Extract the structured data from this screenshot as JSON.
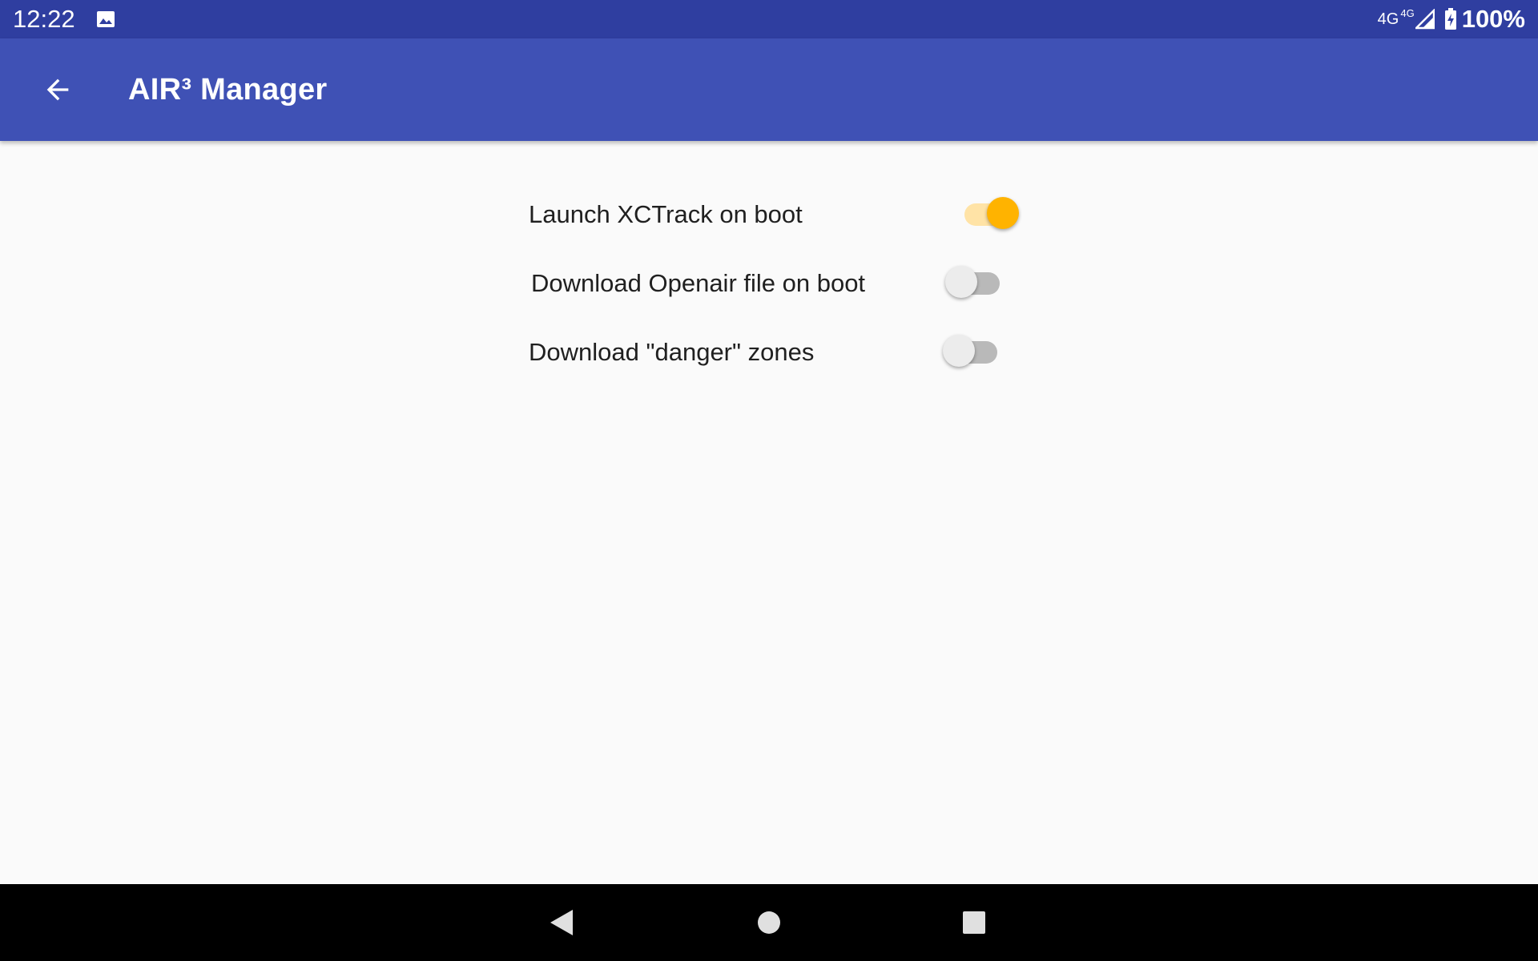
{
  "status_bar": {
    "time": "12:22",
    "network": "4G",
    "network_secondary": "4G",
    "battery": "100%",
    "icons": [
      "image-icon",
      "signal-icon",
      "battery-charging-icon"
    ]
  },
  "app_bar": {
    "title": "AIR³ Manager",
    "back_icon": "arrow-back-icon"
  },
  "settings": [
    {
      "label": "Launch XCTrack on boot",
      "enabled": true
    },
    {
      "label": "Download Openair file on boot",
      "enabled": false
    },
    {
      "label": "Download \"danger\" zones",
      "enabled": false
    }
  ],
  "colors": {
    "status_bar": "#2f3ea0",
    "app_bar": "#3f51b5",
    "switch_on_thumb": "#ffb300",
    "switch_on_track": "#ffe3a6",
    "switch_off_thumb": "#ececec",
    "switch_off_track": "#b9b9b9"
  },
  "nav_bar": {
    "icons": [
      "nav-back-icon",
      "nav-home-icon",
      "nav-recents-icon"
    ]
  }
}
